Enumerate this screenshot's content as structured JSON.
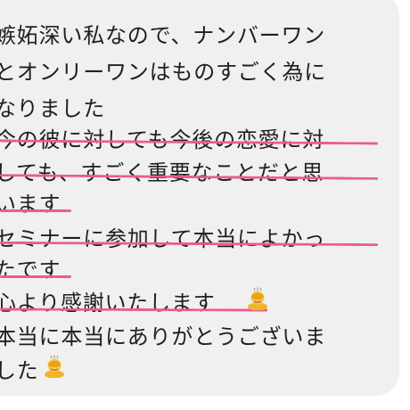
{
  "message": {
    "lines": [
      "嫉妬深い私なので、ナンバーワン",
      "とオンリーワンはものすごく為に",
      "なりました",
      "今の彼に対しても今後の恋愛に対",
      "しても、すごく重要なことだと思",
      "います",
      "セミナーに参加して本当によかっ",
      "たです",
      "心より感謝いたします",
      "本当に本当にありがとうございま",
      "した"
    ],
    "emoji": [
      "bowing-person-emoji",
      "bowing-person-emoji"
    ]
  },
  "colors": {
    "bubble": "#f0f0f0",
    "text": "#1f1f1f",
    "underline": "#ea5c92"
  }
}
